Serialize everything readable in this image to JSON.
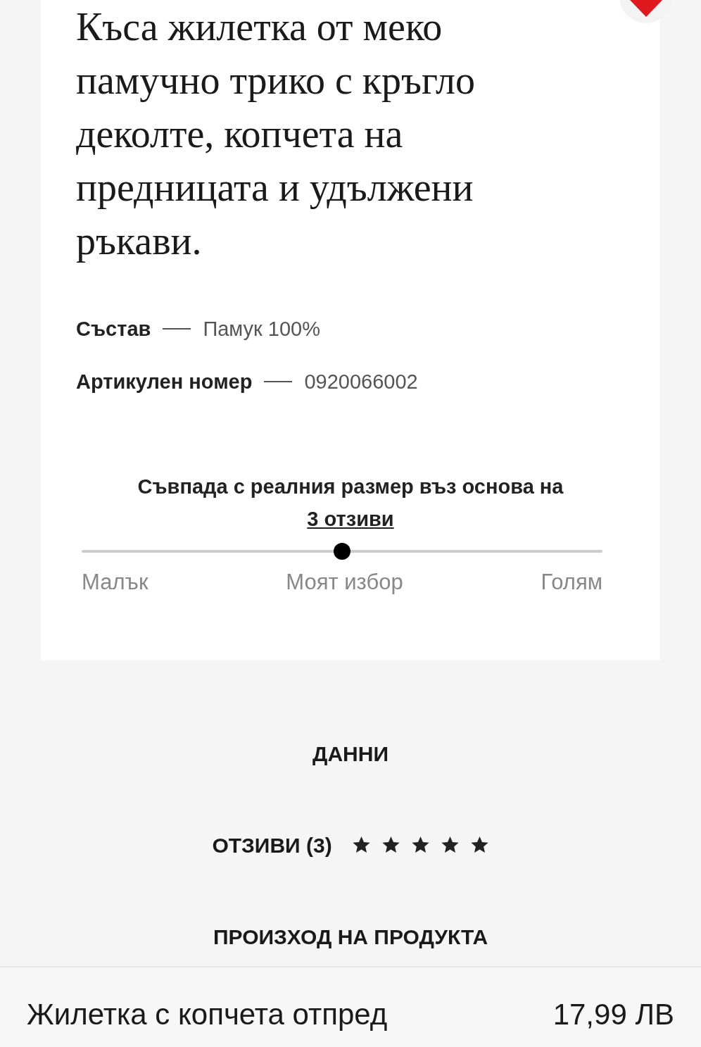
{
  "favorite": {
    "on": true
  },
  "description": "Къса жилетка от меко памучно трико с кръгло деколте, копчета на предницата и удължени ръкави.",
  "details": [
    {
      "label": "Състав",
      "value": "Памук 100%"
    },
    {
      "label": "Артикулен номер",
      "value": "0920066002"
    }
  ],
  "fit": {
    "text": "Съвпада с реалния размер въз основа на",
    "link": "3 отзиви",
    "level": 0.5,
    "labels": [
      "Малък",
      "Моят избор",
      "Голям"
    ]
  },
  "sections": [
    {
      "kind": "plain",
      "label": "ДАННИ"
    },
    {
      "kind": "rating",
      "label": "ОТЗИВИ (3)",
      "stars": 5
    },
    {
      "kind": "plain",
      "label": "ПРОИЗХОД НА ПРОДУКТА"
    }
  ],
  "bottom_bar": {
    "product_name": "Жилетка с копчета отпред",
    "price": "17,99 ЛВ"
  }
}
